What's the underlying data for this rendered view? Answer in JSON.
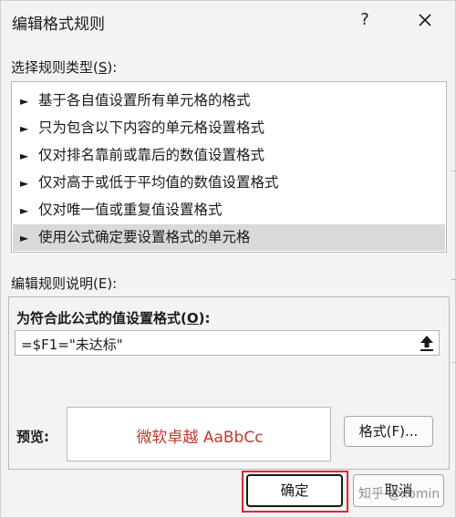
{
  "window": {
    "title": "编辑格式规则",
    "help_label": "?",
    "close_icon": "close-icon"
  },
  "rule_types": {
    "label_prefix": "选择规则类型(",
    "label_key": "S",
    "label_suffix": "):",
    "items": [
      {
        "label": "基于各自值设置所有单元格的格式",
        "selected": false
      },
      {
        "label": "只为包含以下内容的单元格设置格式",
        "selected": false
      },
      {
        "label": "仅对排名靠前或靠后的数值设置格式",
        "selected": false
      },
      {
        "label": "仅对高于或低于平均值的数值设置格式",
        "selected": false
      },
      {
        "label": "仅对唯一值或重复值设置格式",
        "selected": false
      },
      {
        "label": "使用公式确定要设置格式的单元格",
        "selected": true
      }
    ],
    "item_marker": "►"
  },
  "description": {
    "label": "编辑规则说明(E):",
    "formula_label_prefix": "为符合此公式的值设置格式(",
    "formula_label_key": "O",
    "formula_label_suffix": "):",
    "formula_value": "=$F1=\"未达标\"",
    "collapse_icon": "upload-arrow-icon",
    "preview_label": "预览:",
    "preview_text": "微软卓越  AaBbCc",
    "preview_color": "#c0392b",
    "format_button": "格式(F)..."
  },
  "footer": {
    "ok_label": "确定",
    "cancel_label": "取消",
    "highlight_color": "#e0262e"
  },
  "watermark": "知乎 @xomin"
}
